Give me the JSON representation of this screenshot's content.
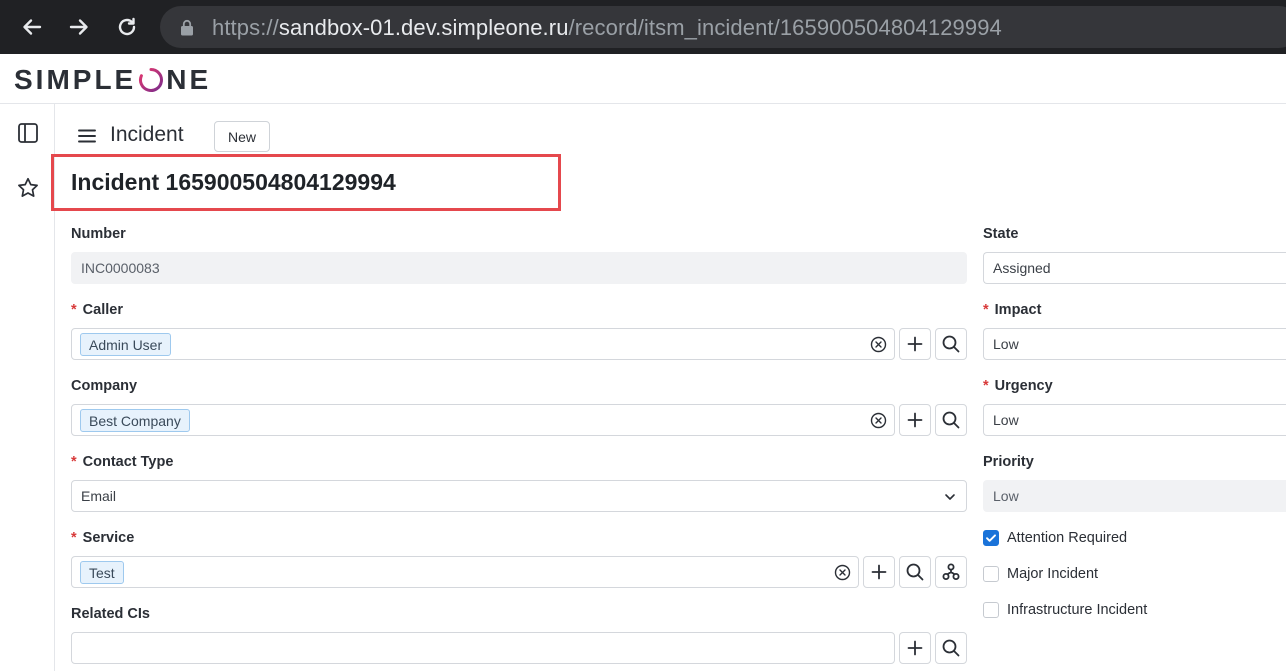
{
  "browser": {
    "url_scheme": "https://",
    "url_host": "sandbox-01.dev.simpleone.ru",
    "url_path": "/record/itsm_incident/165900504804129994"
  },
  "app": {
    "logo_left": "SIMPLE",
    "logo_right": "NE",
    "brand_colors": {
      "logo_ring_start": "#e8386d",
      "logo_ring_end": "#7a2c8c",
      "required": "#d83a3a",
      "checkbox": "#1a73d9"
    }
  },
  "header": {
    "list_title": "Incident",
    "new_label": "New"
  },
  "record": {
    "title": "Incident 165900504804129994"
  },
  "form": {
    "number": {
      "label": "Number",
      "value": "INC0000083"
    },
    "caller": {
      "label": "Caller",
      "required": "*",
      "value": "Admin User"
    },
    "company": {
      "label": "Company",
      "value": "Best Company"
    },
    "contact_type": {
      "label": "Contact Type",
      "required": "*",
      "value": "Email"
    },
    "service": {
      "label": "Service",
      "required": "*",
      "value": "Test"
    },
    "related_cis": {
      "label": "Related CIs",
      "value": ""
    },
    "state": {
      "label": "State",
      "value": "Assigned"
    },
    "impact": {
      "label": "Impact",
      "required": "*",
      "value": "Low"
    },
    "urgency": {
      "label": "Urgency",
      "required": "*",
      "value": "Low"
    },
    "priority": {
      "label": "Priority",
      "value": "Low"
    },
    "attention_required": {
      "label": "Attention Required",
      "checked": true
    },
    "major_incident": {
      "label": "Major Incident",
      "checked": false
    },
    "infrastructure_incident": {
      "label": "Infrastructure Incident",
      "checked": false
    }
  },
  "icons": [
    "back-arrow-icon",
    "forward-arrow-icon",
    "reload-icon",
    "lock-icon",
    "sidebar-panel-icon",
    "star-icon",
    "hamburger-menu-icon",
    "clear-icon",
    "plus-icon",
    "search-icon",
    "chevron-down-icon",
    "hierarchy-icon",
    "checkmark-icon"
  ]
}
